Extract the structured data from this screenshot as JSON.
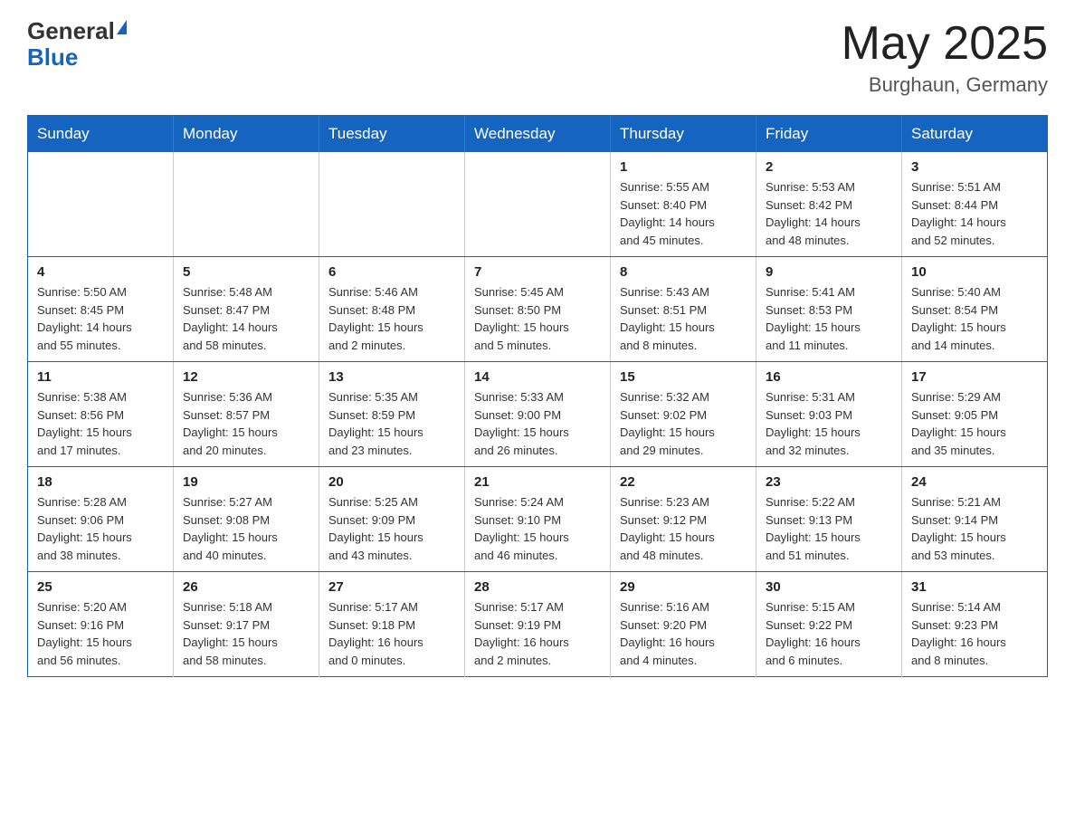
{
  "header": {
    "logo_general": "General",
    "logo_blue": "Blue",
    "month_title": "May 2025",
    "location": "Burghaun, Germany"
  },
  "calendar": {
    "days_of_week": [
      "Sunday",
      "Monday",
      "Tuesday",
      "Wednesday",
      "Thursday",
      "Friday",
      "Saturday"
    ],
    "weeks": [
      [
        {
          "day": "",
          "info": ""
        },
        {
          "day": "",
          "info": ""
        },
        {
          "day": "",
          "info": ""
        },
        {
          "day": "",
          "info": ""
        },
        {
          "day": "1",
          "info": "Sunrise: 5:55 AM\nSunset: 8:40 PM\nDaylight: 14 hours\nand 45 minutes."
        },
        {
          "day": "2",
          "info": "Sunrise: 5:53 AM\nSunset: 8:42 PM\nDaylight: 14 hours\nand 48 minutes."
        },
        {
          "day": "3",
          "info": "Sunrise: 5:51 AM\nSunset: 8:44 PM\nDaylight: 14 hours\nand 52 minutes."
        }
      ],
      [
        {
          "day": "4",
          "info": "Sunrise: 5:50 AM\nSunset: 8:45 PM\nDaylight: 14 hours\nand 55 minutes."
        },
        {
          "day": "5",
          "info": "Sunrise: 5:48 AM\nSunset: 8:47 PM\nDaylight: 14 hours\nand 58 minutes."
        },
        {
          "day": "6",
          "info": "Sunrise: 5:46 AM\nSunset: 8:48 PM\nDaylight: 15 hours\nand 2 minutes."
        },
        {
          "day": "7",
          "info": "Sunrise: 5:45 AM\nSunset: 8:50 PM\nDaylight: 15 hours\nand 5 minutes."
        },
        {
          "day": "8",
          "info": "Sunrise: 5:43 AM\nSunset: 8:51 PM\nDaylight: 15 hours\nand 8 minutes."
        },
        {
          "day": "9",
          "info": "Sunrise: 5:41 AM\nSunset: 8:53 PM\nDaylight: 15 hours\nand 11 minutes."
        },
        {
          "day": "10",
          "info": "Sunrise: 5:40 AM\nSunset: 8:54 PM\nDaylight: 15 hours\nand 14 minutes."
        }
      ],
      [
        {
          "day": "11",
          "info": "Sunrise: 5:38 AM\nSunset: 8:56 PM\nDaylight: 15 hours\nand 17 minutes."
        },
        {
          "day": "12",
          "info": "Sunrise: 5:36 AM\nSunset: 8:57 PM\nDaylight: 15 hours\nand 20 minutes."
        },
        {
          "day": "13",
          "info": "Sunrise: 5:35 AM\nSunset: 8:59 PM\nDaylight: 15 hours\nand 23 minutes."
        },
        {
          "day": "14",
          "info": "Sunrise: 5:33 AM\nSunset: 9:00 PM\nDaylight: 15 hours\nand 26 minutes."
        },
        {
          "day": "15",
          "info": "Sunrise: 5:32 AM\nSunset: 9:02 PM\nDaylight: 15 hours\nand 29 minutes."
        },
        {
          "day": "16",
          "info": "Sunrise: 5:31 AM\nSunset: 9:03 PM\nDaylight: 15 hours\nand 32 minutes."
        },
        {
          "day": "17",
          "info": "Sunrise: 5:29 AM\nSunset: 9:05 PM\nDaylight: 15 hours\nand 35 minutes."
        }
      ],
      [
        {
          "day": "18",
          "info": "Sunrise: 5:28 AM\nSunset: 9:06 PM\nDaylight: 15 hours\nand 38 minutes."
        },
        {
          "day": "19",
          "info": "Sunrise: 5:27 AM\nSunset: 9:08 PM\nDaylight: 15 hours\nand 40 minutes."
        },
        {
          "day": "20",
          "info": "Sunrise: 5:25 AM\nSunset: 9:09 PM\nDaylight: 15 hours\nand 43 minutes."
        },
        {
          "day": "21",
          "info": "Sunrise: 5:24 AM\nSunset: 9:10 PM\nDaylight: 15 hours\nand 46 minutes."
        },
        {
          "day": "22",
          "info": "Sunrise: 5:23 AM\nSunset: 9:12 PM\nDaylight: 15 hours\nand 48 minutes."
        },
        {
          "day": "23",
          "info": "Sunrise: 5:22 AM\nSunset: 9:13 PM\nDaylight: 15 hours\nand 51 minutes."
        },
        {
          "day": "24",
          "info": "Sunrise: 5:21 AM\nSunset: 9:14 PM\nDaylight: 15 hours\nand 53 minutes."
        }
      ],
      [
        {
          "day": "25",
          "info": "Sunrise: 5:20 AM\nSunset: 9:16 PM\nDaylight: 15 hours\nand 56 minutes."
        },
        {
          "day": "26",
          "info": "Sunrise: 5:18 AM\nSunset: 9:17 PM\nDaylight: 15 hours\nand 58 minutes."
        },
        {
          "day": "27",
          "info": "Sunrise: 5:17 AM\nSunset: 9:18 PM\nDaylight: 16 hours\nand 0 minutes."
        },
        {
          "day": "28",
          "info": "Sunrise: 5:17 AM\nSunset: 9:19 PM\nDaylight: 16 hours\nand 2 minutes."
        },
        {
          "day": "29",
          "info": "Sunrise: 5:16 AM\nSunset: 9:20 PM\nDaylight: 16 hours\nand 4 minutes."
        },
        {
          "day": "30",
          "info": "Sunrise: 5:15 AM\nSunset: 9:22 PM\nDaylight: 16 hours\nand 6 minutes."
        },
        {
          "day": "31",
          "info": "Sunrise: 5:14 AM\nSunset: 9:23 PM\nDaylight: 16 hours\nand 8 minutes."
        }
      ]
    ]
  }
}
